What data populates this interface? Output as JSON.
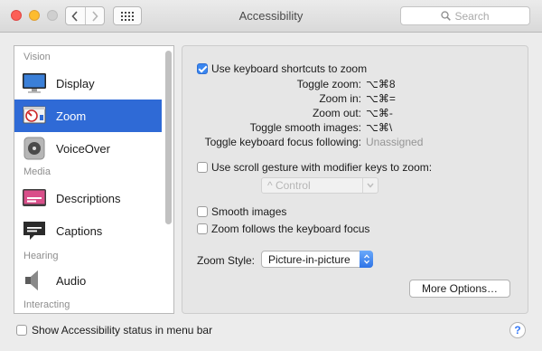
{
  "window": {
    "title": "Accessibility"
  },
  "toolbar": {
    "search_placeholder": "Search"
  },
  "sidebar": {
    "sections": [
      {
        "label": "Vision"
      },
      {
        "label": "Media"
      },
      {
        "label": "Hearing"
      },
      {
        "label": "Interacting"
      }
    ],
    "items": [
      {
        "label": "Display",
        "icon": "display-icon"
      },
      {
        "label": "Zoom",
        "icon": "zoom-icon",
        "selected": true
      },
      {
        "label": "VoiceOver",
        "icon": "voiceover-icon"
      },
      {
        "label": "Descriptions",
        "icon": "descriptions-icon"
      },
      {
        "label": "Captions",
        "icon": "captions-icon"
      },
      {
        "label": "Audio",
        "icon": "audio-icon"
      }
    ]
  },
  "zoom": {
    "keyboard_shortcuts": {
      "label": "Use keyboard shortcuts to zoom",
      "checked": true
    },
    "shortcuts": [
      {
        "label": "Toggle zoom:",
        "value": "⌥⌘8"
      },
      {
        "label": "Zoom in:",
        "value": "⌥⌘="
      },
      {
        "label": "Zoom out:",
        "value": "⌥⌘-"
      },
      {
        "label": "Toggle smooth images:",
        "value": "⌥⌘\\"
      },
      {
        "label": "Toggle keyboard focus following:",
        "value": "Unassigned"
      }
    ],
    "scroll_gesture": {
      "label": "Use scroll gesture with modifier keys to zoom:",
      "checked": false
    },
    "modifier_popup": "^ Control",
    "smooth_images": {
      "label": "Smooth images",
      "checked": false
    },
    "follows_focus": {
      "label": "Zoom follows the keyboard focus",
      "checked": false
    },
    "zoom_style_label": "Zoom Style:",
    "zoom_style_value": "Picture-in-picture",
    "more_options": "More Options…"
  },
  "footer": {
    "status_label": "Show Accessibility status in menu bar",
    "help": "?"
  },
  "colors": {
    "selection": "#2f6ad6",
    "accent": "#3a86f0"
  }
}
